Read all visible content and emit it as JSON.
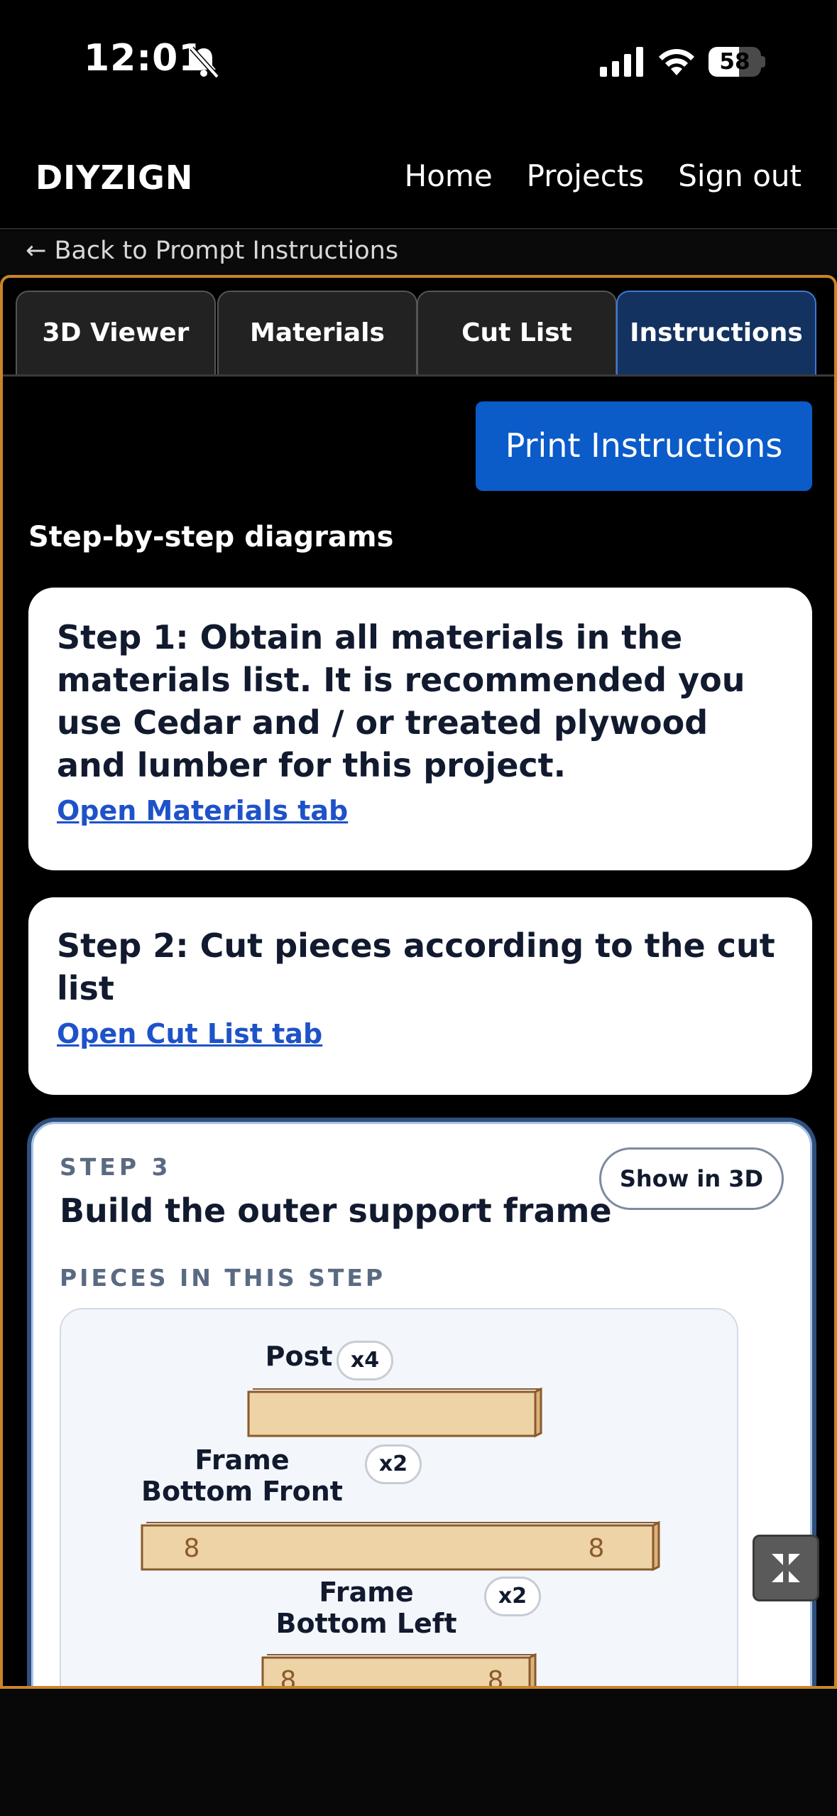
{
  "status_bar": {
    "time": "12:01",
    "battery_percent": "58",
    "battery_level": 0.58
  },
  "nav": {
    "brand": "DIYZIGN",
    "links": [
      "Home",
      "Projects",
      "Sign out"
    ]
  },
  "back_link": "← Back to Prompt Instructions",
  "tabs": [
    {
      "label": "3D Viewer",
      "active": false
    },
    {
      "label": "Materials",
      "active": false
    },
    {
      "label": "Cut List",
      "active": false
    },
    {
      "label": "Instructions",
      "active": true
    }
  ],
  "print_button": "Print Instructions",
  "section_title": "Step-by-step diagrams",
  "steps": [
    {
      "title": "Step 1: Obtain all materials in the materials list. It is recommended you use Cedar and / or treated plywood and lumber for this project.",
      "link": "Open Materials tab"
    },
    {
      "title": "Step 2: Cut pieces according to the cut list",
      "link": "Open Cut List tab"
    }
  ],
  "step3": {
    "label": "STEP 3",
    "title": "Build the outer support frame",
    "show_3d": "Show in 3D",
    "pieces_label": "PIECES IN THIS STEP",
    "pieces": [
      {
        "name": "Post",
        "qty": "x4"
      },
      {
        "name": "Frame Bottom Front",
        "qty": "x2"
      },
      {
        "name": "Frame Bottom Left",
        "qty": "x2"
      }
    ],
    "screw_mark": "8"
  },
  "colors": {
    "accent_blue": "#0b5bc9",
    "frame_orange": "#c9852a",
    "wood": "#eed3a6",
    "wood_edge": "#8a5a2b"
  }
}
